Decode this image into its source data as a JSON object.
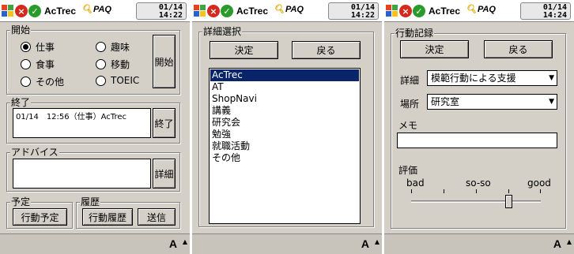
{
  "screens": [
    {
      "status": {
        "app_title": "AcTrec",
        "paq": "PAQ",
        "date": "01/14",
        "time": "14:22"
      },
      "start_group": {
        "label": "開始"
      },
      "radios": [
        {
          "label": "仕事",
          "selected": true
        },
        {
          "label": "趣味",
          "selected": false
        },
        {
          "label": "食事",
          "selected": false
        },
        {
          "label": "移動",
          "selected": false
        },
        {
          "label": "その他",
          "selected": false
        },
        {
          "label": "TOEIC",
          "selected": false
        }
      ],
      "start_button": "開始",
      "end_group": {
        "label": "終了",
        "entry": "01/14　12:56（仕事）AcTrec",
        "button": "終了"
      },
      "advice_group": {
        "label": "アドバイス",
        "button": "詳細"
      },
      "plan_group": {
        "label": "予定",
        "button": "行動予定"
      },
      "history_group": {
        "label": "履歴",
        "history_button": "行動履歴",
        "send_button": "送信"
      },
      "sip": "A"
    },
    {
      "status": {
        "app_title": "AcTrec",
        "paq": "PAQ",
        "date": "01/14",
        "time": "14:22"
      },
      "group_label": "詳細選択",
      "ok_button": "決定",
      "back_button": "戻る",
      "list": [
        "AcTrec",
        "AT",
        "ShopNavi",
        "講義",
        "研究会",
        "勉強",
        "就職活動",
        "その他"
      ],
      "selected_index": 0,
      "sip": "A"
    },
    {
      "status": {
        "app_title": "AcTrec",
        "paq": "PAQ",
        "date": "01/14",
        "time": "14:24"
      },
      "group_label": "行動記録",
      "ok_button": "決定",
      "back_button": "戻る",
      "detail_label": "詳細",
      "detail_value": "模範行動による支援",
      "place_label": "場所",
      "place_value": "研究室",
      "memo_label": "メモ",
      "memo_value": "",
      "rating_label": "評価",
      "rating_bad": "bad",
      "rating_soso": "so-so",
      "rating_good": "good",
      "rating_value": 0.75,
      "sip": "A"
    }
  ],
  "colors": {
    "background": "#d4d0c8",
    "selection": "#0a246a",
    "close_icon": "#d42a1e",
    "ok_icon": "#2a9a2a"
  }
}
